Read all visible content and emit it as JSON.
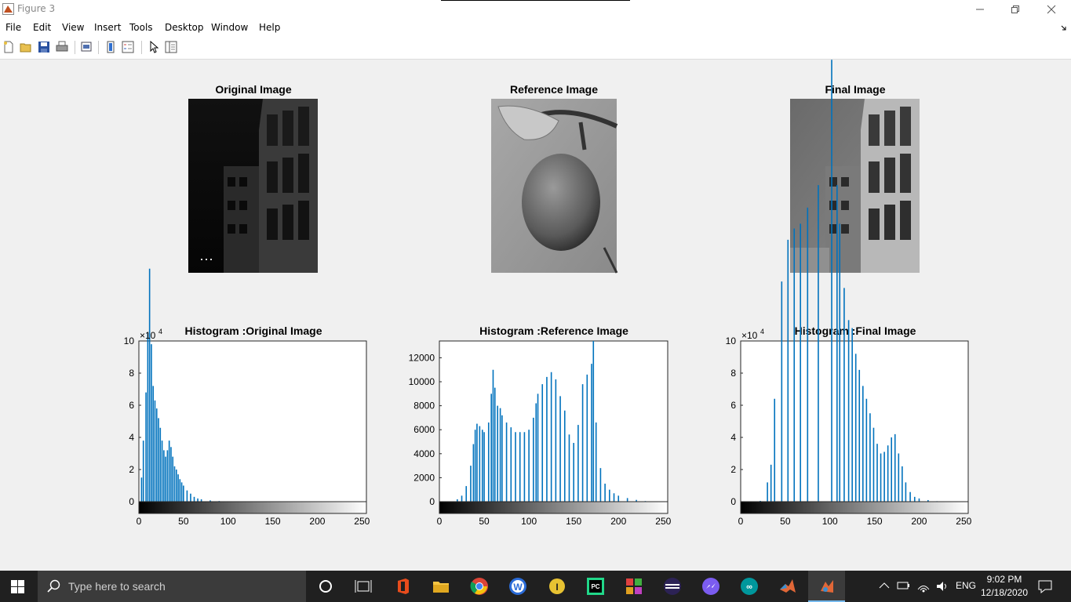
{
  "window": {
    "title": "Figure 3"
  },
  "menu": [
    "File",
    "Edit",
    "View",
    "Insert",
    "Tools",
    "Desktop",
    "Window",
    "Help"
  ],
  "toolbar": [
    "new-figure-icon",
    "open-file-icon",
    "save-icon",
    "print-icon",
    "print-preview-icon",
    "colorbar-icon",
    "legend-icon",
    "pointer-icon",
    "property-editor-icon"
  ],
  "images": [
    {
      "title": "Original Image"
    },
    {
      "title": "Reference Image"
    },
    {
      "title": "Final Image"
    }
  ],
  "histograms": [
    {
      "title": "Histogram :Original Image",
      "multiplier": "×10",
      "exponent": "4",
      "yticks": [
        "0",
        "2",
        "4",
        "6",
        "8",
        "10"
      ],
      "xticks": [
        "0",
        "50",
        "100",
        "150",
        "200",
        "250"
      ]
    },
    {
      "title": "Histogram :Reference Image",
      "multiplier": "",
      "exponent": "",
      "yticks": [
        "0",
        "2000",
        "4000",
        "6000",
        "8000",
        "10000",
        "12000"
      ],
      "xticks": [
        "0",
        "50",
        "100",
        "150",
        "200",
        "250"
      ]
    },
    {
      "title": "Histogram :Final Image",
      "multiplier": "×10",
      "exponent": "4",
      "yticks": [
        "0",
        "2",
        "4",
        "6",
        "8",
        "10"
      ],
      "xticks": [
        "0",
        "50",
        "100",
        "150",
        "200",
        "250"
      ]
    }
  ],
  "chart_data": [
    {
      "type": "bar",
      "title": "Histogram :Original Image",
      "xlim": [
        0,
        255
      ],
      "ylim": [
        0,
        100000
      ],
      "color": "#0072bd",
      "x": [
        3,
        5,
        8,
        10,
        12,
        14,
        16,
        18,
        20,
        22,
        24,
        26,
        28,
        30,
        32,
        34,
        36,
        38,
        40,
        42,
        44,
        46,
        48,
        50,
        54,
        58,
        62,
        66,
        70,
        80,
        90,
        100
      ],
      "y": [
        15000,
        38000,
        68000,
        105000,
        145000,
        98000,
        72000,
        63000,
        58000,
        52000,
        46000,
        38000,
        32000,
        28000,
        32000,
        38000,
        34000,
        28000,
        22000,
        20000,
        17000,
        14000,
        12000,
        10000,
        7000,
        5000,
        3000,
        2000,
        1500,
        800,
        400,
        200
      ]
    },
    {
      "type": "bar",
      "title": "Histogram :Reference Image",
      "xlim": [
        0,
        255
      ],
      "ylim": [
        0,
        13400
      ],
      "color": "#0072bd",
      "x": [
        20,
        25,
        30,
        35,
        38,
        40,
        42,
        45,
        48,
        50,
        55,
        58,
        60,
        62,
        65,
        68,
        70,
        75,
        80,
        85,
        90,
        95,
        100,
        105,
        108,
        110,
        115,
        120,
        125,
        130,
        135,
        140,
        145,
        150,
        155,
        160,
        165,
        170,
        172,
        175,
        180,
        185,
        190,
        195,
        200,
        210,
        220,
        230
      ],
      "y": [
        200,
        500,
        1300,
        3000,
        4800,
        6000,
        6500,
        6300,
        6000,
        5800,
        6600,
        9000,
        11000,
        9500,
        8000,
        7800,
        7200,
        6600,
        6200,
        5800,
        5800,
        5800,
        6000,
        7000,
        8200,
        9000,
        9800,
        10400,
        10800,
        10200,
        8800,
        7600,
        5600,
        4900,
        6400,
        9800,
        10600,
        11500,
        13400,
        6600,
        2800,
        1500,
        1000,
        700,
        500,
        300,
        150,
        50
      ]
    },
    {
      "type": "bar",
      "title": "Histogram :Final Image",
      "xlim": [
        0,
        255
      ],
      "ylim": [
        0,
        100000
      ],
      "color": "#0072bd",
      "x": [
        22,
        30,
        34,
        38,
        46,
        53,
        60,
        67,
        75,
        87,
        102,
        108,
        111,
        116,
        121,
        125,
        129,
        133,
        137,
        141,
        145,
        149,
        153,
        157,
        161,
        165,
        169,
        173,
        177,
        181,
        185,
        190,
        195,
        200,
        210,
        220
      ],
      "y": [
        500,
        12000,
        23000,
        64000,
        137000,
        163000,
        170000,
        173000,
        183000,
        197000,
        275000,
        197000,
        173000,
        133000,
        113000,
        108000,
        92000,
        82000,
        72000,
        64000,
        55000,
        46000,
        36000,
        30000,
        31000,
        35000,
        40000,
        42000,
        30000,
        22000,
        12000,
        6000,
        3000,
        2000,
        1000,
        300
      ]
    }
  ]
}
